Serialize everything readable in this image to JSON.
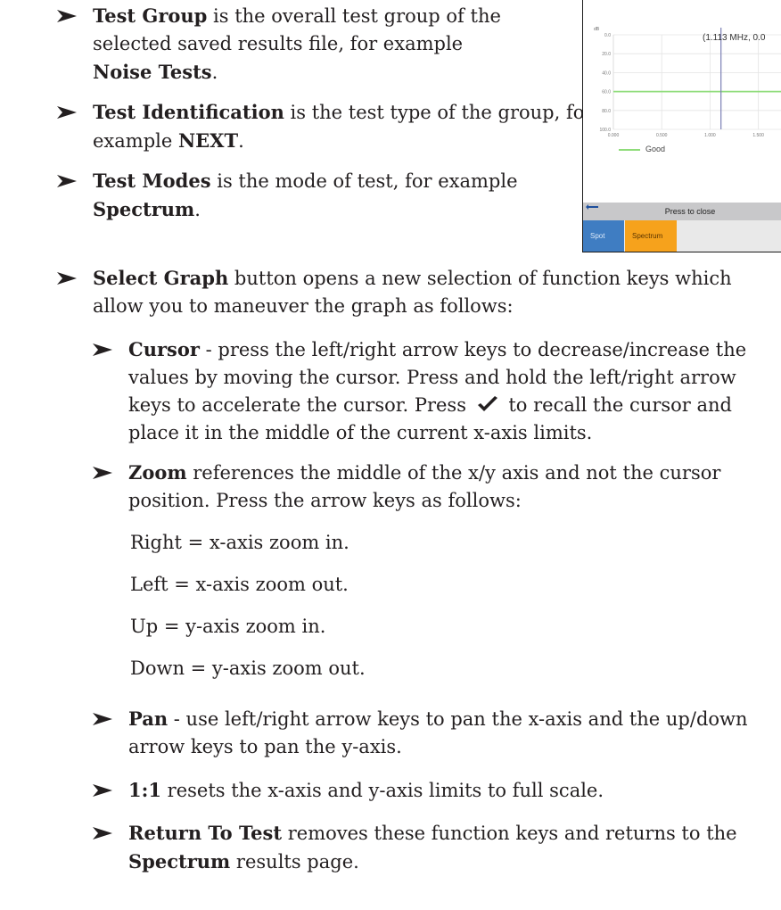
{
  "bullets_top": [
    {
      "lines": [
        [
          {
            "b": "Test Group"
          },
          {
            "t": " is the overall test group of the"
          }
        ],
        [
          {
            "t": "selected saved results file, for example"
          }
        ],
        [
          {
            "b": "Noise Tests"
          },
          {
            "t": "."
          }
        ]
      ]
    },
    {
      "lines": [
        [
          {
            "b": "Test Identification"
          },
          {
            "t": " is the test type of the group, for"
          }
        ],
        [
          {
            "t": "example "
          },
          {
            "b": "NEXT"
          },
          {
            "t": "."
          }
        ]
      ]
    },
    {
      "lines": [
        [
          {
            "b": "Test Modes"
          },
          {
            "t": " is the mode of test, for example"
          }
        ],
        [
          {
            "b": "Spectrum"
          },
          {
            "t": "."
          }
        ]
      ]
    }
  ],
  "select_graph": {
    "lines": [
      [
        {
          "b": "Select Graph"
        },
        {
          "t": " button opens a new selection of function keys which"
        }
      ],
      [
        {
          "t": "allow you to maneuver the graph as follows:"
        }
      ]
    ]
  },
  "cursor": {
    "lines": [
      [
        {
          "b": "Cursor"
        },
        {
          "t": " - press the left/right arrow keys to decrease/increase the"
        }
      ],
      [
        {
          "t": "values by moving the cursor. Press and hold the left/right arrow"
        }
      ],
      [
        {
          "t": "keys to accelerate the cursor. Press "
        },
        {
          "icon": "check"
        },
        {
          "t": " to recall the cursor and"
        }
      ],
      [
        {
          "t": "place it in the middle of the current x-axis limits."
        }
      ]
    ]
  },
  "zoom": {
    "lines": [
      [
        {
          "b": "Zoom"
        },
        {
          "t": " references the middle of the x/y axis and not the cursor"
        }
      ],
      [
        {
          "t": "position. Press the arrow keys as follows:"
        }
      ]
    ]
  },
  "zoom_items": [
    "Right = x-axis zoom in.",
    "Left = x-axis zoom out.",
    "Up = y-axis zoom in.",
    "Down = y-axis zoom out."
  ],
  "pan": {
    "lines": [
      [
        {
          "b": "Pan"
        },
        {
          "t": " - use left/right arrow keys to pan the x-axis and the up/down"
        }
      ],
      [
        {
          "t": "arrow keys to pan the y-axis."
        }
      ]
    ]
  },
  "one_to_one": {
    "lines": [
      [
        {
          "b": "1:1"
        },
        {
          "t": " resets the x-axis and y-axis limits to full scale."
        }
      ]
    ]
  },
  "return_to_test": {
    "lines": [
      [
        {
          "b": "Return To Test"
        },
        {
          "t": " removes these function keys and returns to the"
        }
      ],
      [
        {
          "b": "Spectrum"
        },
        {
          "t": " results page."
        }
      ]
    ]
  },
  "device": {
    "cursor_readout": "(1.113 MHz, 0.0",
    "y_unit": "dB",
    "y_ticks": [
      "0.0",
      "20.0",
      "40.0",
      "60.0",
      "80.0",
      "100.0"
    ],
    "x_ticks": [
      "0.000",
      "0.500",
      "1.000",
      "1.500"
    ],
    "good_line_value": 60.0,
    "cursor_x": 1.113,
    "legend_label": "Good",
    "status_press": "Press",
    "status_suffix": "to close",
    "key_spot": "Spot",
    "key_spectrum": "Spectrum",
    "colors": {
      "good": "#8fdc7a",
      "cursor": "#7b7fb5",
      "spot": "#3f7dc2",
      "spectrum": "#f6a21c"
    }
  }
}
